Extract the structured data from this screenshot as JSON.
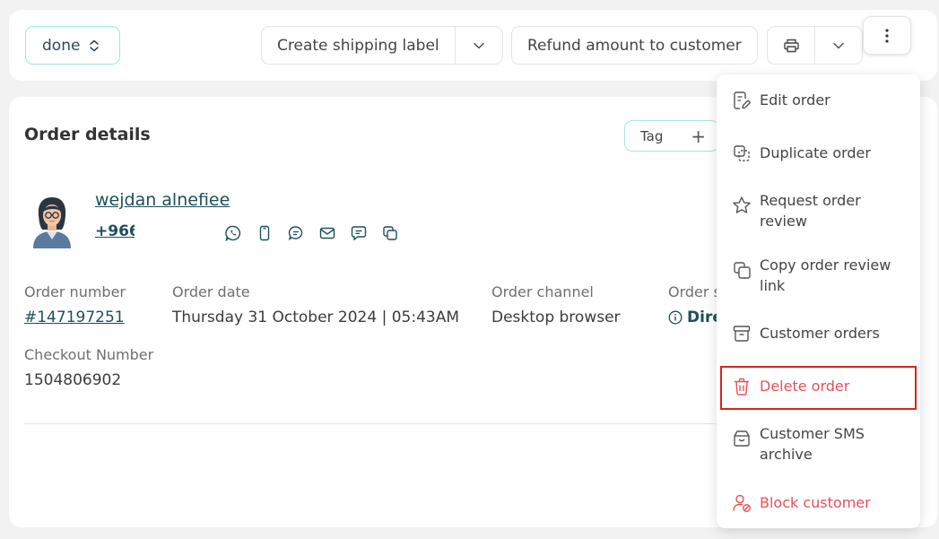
{
  "toolbar": {
    "status_label": "done",
    "shipping_label": "Create shipping label",
    "refund_label": "Refund amount to customer"
  },
  "order": {
    "title": "Order details",
    "tag_label": "Tag",
    "customer_name": "wejdan alnefiee",
    "customer_phone": "+966",
    "fields": {
      "number_label": "Order number",
      "number_value": "#147197251",
      "date_label": "Order date",
      "date_value": "Thursday 31 October 2024 | 05:43AM",
      "channel_label": "Order channel",
      "channel_value": "Desktop browser",
      "source_label": "Order s",
      "source_value": "Dire",
      "checkout_label": "Checkout Number",
      "checkout_value": "1504806902"
    }
  },
  "menu": {
    "items": [
      {
        "label": "Edit order",
        "icon": "edit-order-icon"
      },
      {
        "label": "Duplicate order",
        "icon": "duplicate-icon"
      },
      {
        "label": "Request order\nreview",
        "icon": "star-icon"
      },
      {
        "label": "Copy order review\nlink",
        "icon": "copy-icon"
      },
      {
        "label": "Customer orders",
        "icon": "archive-box-icon"
      },
      {
        "label": "Delete order",
        "icon": "trash-icon"
      },
      {
        "label": "Customer SMS\narchive",
        "icon": "sms-archive-icon"
      },
      {
        "label": "Block customer",
        "icon": "block-user-icon"
      }
    ]
  },
  "colors": {
    "accent": "#1d4f5b",
    "teal_border": "#a6e4da",
    "danger": "#e8505b",
    "highlight": "#d9241f"
  }
}
